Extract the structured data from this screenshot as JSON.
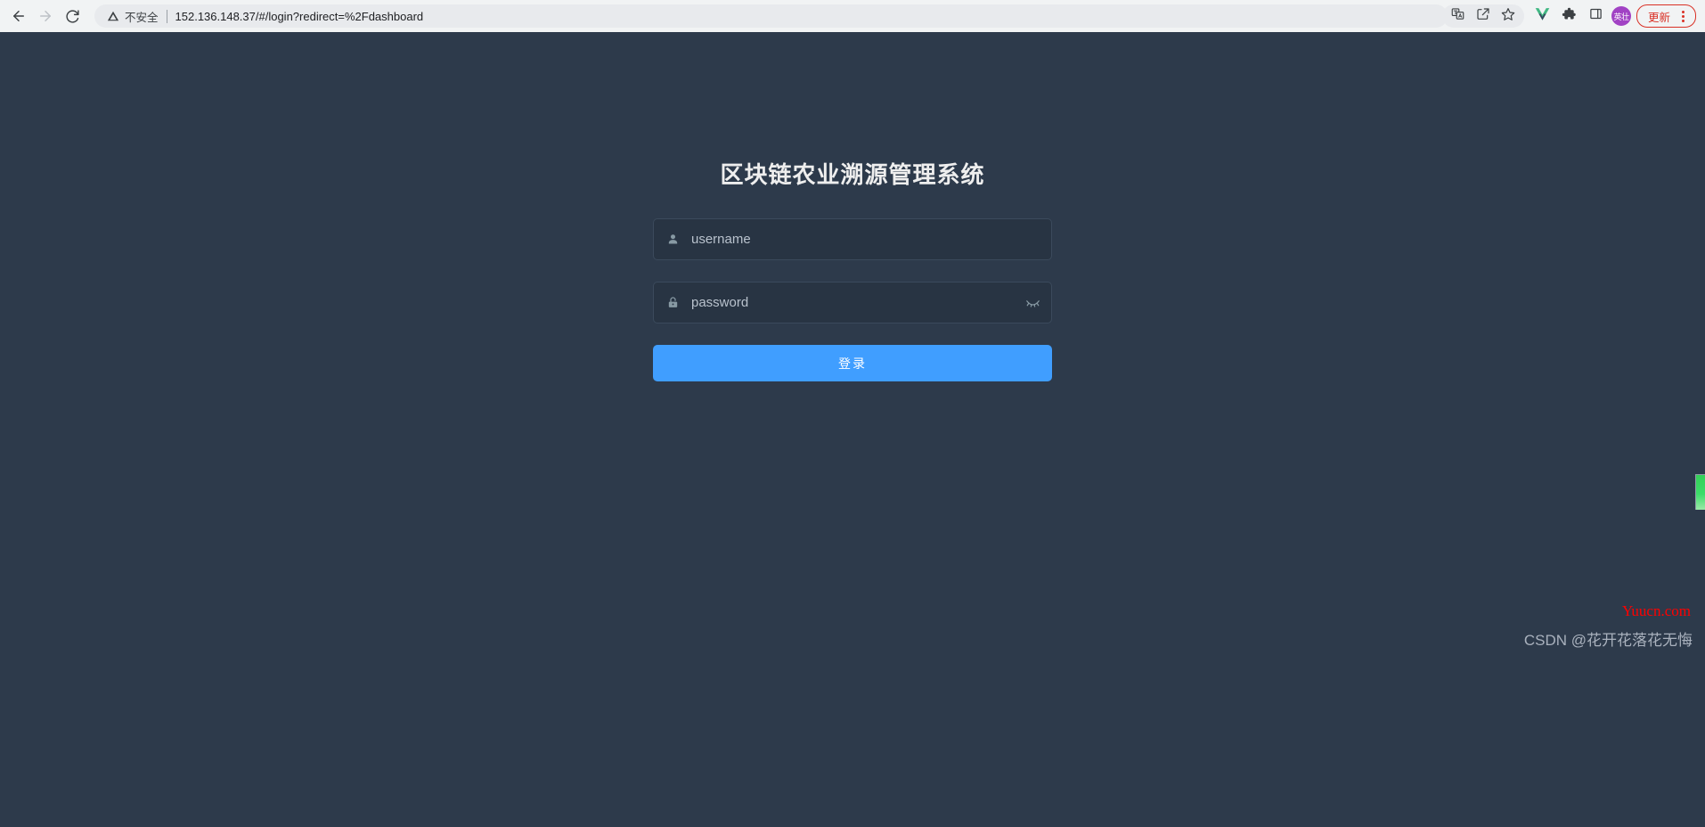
{
  "browser": {
    "back_icon": "back-arrow-icon",
    "forward_icon": "forward-arrow-icon",
    "reload_icon": "reload-icon",
    "security_label": "不安全",
    "url": "152.136.148.37/#/login?redirect=%2Fdashboard",
    "toolbar": {
      "translate_icon": "translate-icon",
      "share_icon": "share-icon",
      "bookmark_icon": "bookmark-star-icon",
      "vue_devtools_icon": "vue-devtools-icon",
      "extensions_icon": "extensions-puzzle-icon",
      "side_panel_icon": "side-panel-icon",
      "profile_initials": "英壮",
      "update_label": "更新",
      "menu_icon": "kebab-menu-icon"
    },
    "colors": {
      "chrome_bg": "#f1f3f4",
      "omnibox_bg": "#e8eaed",
      "update_red": "#d93025",
      "profile_purple": "#a142c4"
    }
  },
  "login": {
    "title": "区块链农业溯源管理系统",
    "username": {
      "icon": "user-icon",
      "placeholder": "username",
      "value": ""
    },
    "password": {
      "icon": "lock-icon",
      "placeholder": "password",
      "value": "",
      "visibility_icon": "eye-closed-icon"
    },
    "submit_label": "登录",
    "colors": {
      "page_bg": "#2d3a4b",
      "field_bg": "#283443",
      "primary": "#409eff",
      "title": "#eeeeee"
    }
  },
  "watermarks": {
    "site": "Yuucn.com",
    "author": "CSDN @花开花落花无悔"
  },
  "indicator": {
    "name": "green-edge-indicator",
    "color": "#3ddc6a"
  }
}
